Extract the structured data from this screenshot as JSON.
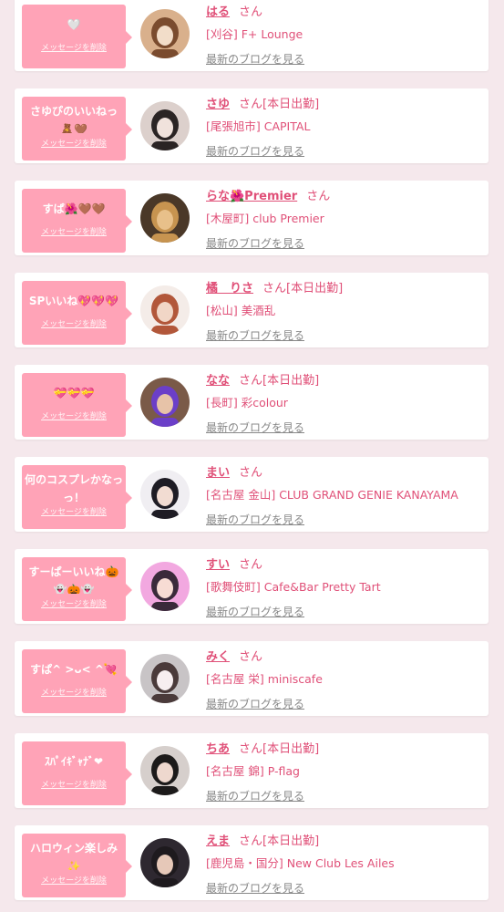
{
  "common": {
    "delete_label": "メッセージを削除",
    "blog_label": "最新のブログを見る",
    "san": "さん"
  },
  "colors": {
    "bubble": "#ffa3b7",
    "accent": "#e05078",
    "link_gray": "#888888",
    "background": "#f5e8ec"
  },
  "items": [
    {
      "message": "🤍",
      "name": "はる",
      "tag": "",
      "shop": "[刈谷] F+ Lounge",
      "lines": 1,
      "avatar": [
        "#d9b08c",
        "#7a4b2e",
        "#f2ddc9"
      ]
    },
    {
      "message": "さゆぴのいいねっ🧸🤎",
      "name": "さゆ",
      "tag": "[本日出勤]",
      "shop": "[尾張旭市] CAPITAL",
      "lines": 2,
      "avatar": [
        "#dcd0cc",
        "#2a2424",
        "#f0e2dc"
      ]
    },
    {
      "message": "すぱ🌺🤎🤎",
      "name": "らな🌺Premier",
      "tag": "",
      "shop": "[木屋町] club Premier",
      "lines": 1,
      "avatar": [
        "#4a3828",
        "#c79450",
        "#e8c08a"
      ]
    },
    {
      "message": "SPいいね💖💖💖",
      "name": "橘　りさ",
      "tag": "[本日出勤]",
      "shop": "[松山] 美酒乱",
      "lines": 1,
      "avatar": [
        "#f4ece8",
        "#b2573a",
        "#f1d6c6"
      ]
    },
    {
      "message": "💝💝💝",
      "name": "なな",
      "tag": "[本日出勤]",
      "shop": "[長町] 彩colour",
      "lines": 1,
      "avatar": [
        "#7a5a48",
        "#6b3fc8",
        "#e7c3a8"
      ]
    },
    {
      "message": "何のコスプレかなっっ！",
      "name": "まい",
      "tag": "",
      "shop": "[名古屋 金山] CLUB GRAND GENIE KANAYAMA",
      "lines": 2,
      "avatar": [
        "#f0eef2",
        "#1e1c24",
        "#f2dcd2"
      ]
    },
    {
      "message": "すーぱーいいね🎃👻🎃👻",
      "name": "すい",
      "tag": "",
      "shop": "[歌舞伎町] Cafe&Bar Pretty Tart",
      "lines": 2,
      "avatar": [
        "#f2a8e0",
        "#3a2a3a",
        "#f7dcd4"
      ]
    },
    {
      "message": "すぱ^ >ᴗ< ^💘",
      "name": "みく",
      "tag": "",
      "shop": "[名古屋 栄] miniscafe",
      "lines": 1,
      "avatar": [
        "#c8c4c6",
        "#4a3a3a",
        "#f7eef0"
      ]
    },
    {
      "message": "ｽﾊﾟｲｷﾞｬﾅﾞ❤",
      "name": "ちあ",
      "tag": "[本日出勤]",
      "shop": "[名古屋 錦] P-flag",
      "lines": 1,
      "avatar": [
        "#d6cfcc",
        "#1c1a1a",
        "#eed8ce"
      ]
    },
    {
      "message": "ハロウィン楽しみ✨",
      "name": "えま",
      "tag": "[本日出勤]",
      "shop": "[鹿児島・国分] New Club Les Ailes",
      "lines": 2,
      "avatar": [
        "#2e2830",
        "#1e1a1e",
        "#e6c8b8"
      ]
    }
  ]
}
